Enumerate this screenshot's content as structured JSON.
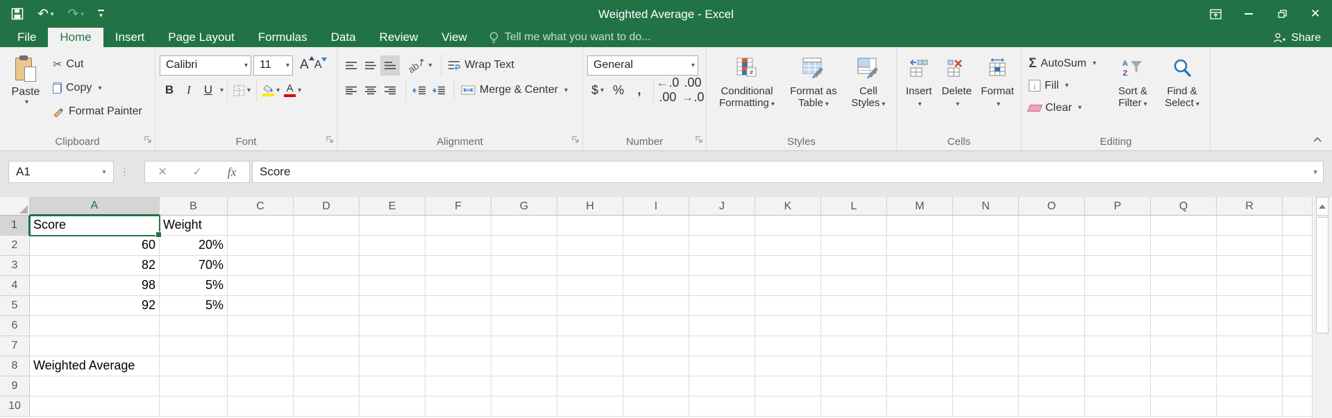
{
  "window": {
    "title": "Weighted Average - Excel",
    "share_label": "Share",
    "tell_me": "Tell me what you want to do..."
  },
  "tabs": [
    {
      "label": "File",
      "active": false
    },
    {
      "label": "Home",
      "active": true
    },
    {
      "label": "Insert",
      "active": false
    },
    {
      "label": "Page Layout",
      "active": false
    },
    {
      "label": "Formulas",
      "active": false
    },
    {
      "label": "Data",
      "active": false
    },
    {
      "label": "Review",
      "active": false
    },
    {
      "label": "View",
      "active": false
    }
  ],
  "ribbon": {
    "clipboard": {
      "label": "Clipboard",
      "paste": "Paste",
      "cut": "Cut",
      "copy": "Copy",
      "format_painter": "Format Painter"
    },
    "font": {
      "label": "Font",
      "family": "Calibri",
      "size": "11",
      "bold": "B",
      "italic": "I",
      "underline": "U",
      "grow": "A",
      "shrink": "A",
      "color_letter": "A"
    },
    "alignment": {
      "label": "Alignment",
      "orientation_glyph": "ab",
      "wrap": "Wrap Text",
      "merge": "Merge & Center"
    },
    "number": {
      "label": "Number",
      "format": "General",
      "currency": "$",
      "percent": "%",
      "comma": ",",
      "inc_top": ".0",
      "inc_bot": ".00",
      "dec_top": ".00",
      "dec_bot": ".0"
    },
    "styles": {
      "label": "Styles",
      "conditional": "Conditional Formatting",
      "format_table": "Format as Table",
      "cell_styles": "Cell Styles"
    },
    "cells": {
      "label": "Cells",
      "insert": "Insert",
      "delete": "Delete",
      "format": "Format"
    },
    "editing": {
      "label": "Editing",
      "autosum": "AutoSum",
      "fill": "Fill",
      "clear": "Clear",
      "sort_filter": "Sort & Filter",
      "find_select": "Find & Select"
    }
  },
  "formula_bar": {
    "name_box": "A1",
    "fx_label": "fx",
    "formula": "Score"
  },
  "sheet": {
    "selected_cell": "A1",
    "columns": [
      "A",
      "B",
      "C",
      "D",
      "E",
      "F",
      "G",
      "H",
      "I",
      "J",
      "K",
      "L",
      "M",
      "N",
      "O",
      "P",
      "Q",
      "R"
    ],
    "row_count": 10,
    "cells": {
      "A1": "Score",
      "B1": "Weight",
      "A2": "60",
      "B2": "20%",
      "A3": "82",
      "B3": "70%",
      "A4": "98",
      "B4": "5%",
      "A5": "92",
      "B5": "5%",
      "A8": "Weighted Average"
    },
    "right_aligned": [
      "A2",
      "A3",
      "A4",
      "A5",
      "B2",
      "B3",
      "B4",
      "B5"
    ]
  },
  "colors": {
    "accent_green": "#217346",
    "fill_yellow": "#ffe600",
    "font_color_red": "#e00000",
    "selected_header_bg": "#d5d5d5"
  }
}
